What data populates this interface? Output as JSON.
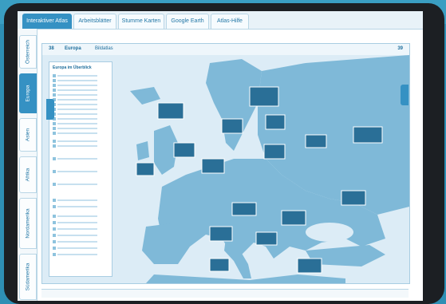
{
  "top_nav": {
    "tabs": [
      {
        "label": "Interaktiver Atlas",
        "active": true
      },
      {
        "label": "Arbeitsblätter",
        "active": false
      },
      {
        "label": "Stumme Karten",
        "active": false
      },
      {
        "label": "Google Earth",
        "active": false
      },
      {
        "label": "Atlas-Hilfe",
        "active": false
      }
    ]
  },
  "side_nav": {
    "items": [
      {
        "label": "Österreich",
        "active": false
      },
      {
        "label": "Europa",
        "active": true
      },
      {
        "label": "Asien",
        "active": false
      },
      {
        "label": "Afrika",
        "active": false
      },
      {
        "label": "Nordamerika",
        "active": false
      },
      {
        "label": "Südamerika",
        "active": false
      }
    ]
  },
  "page": {
    "left_number": "38",
    "right_number": "39",
    "title": "Europa",
    "subtitle": "Bildatlas"
  },
  "legend": {
    "title": "Europa im Überblick"
  },
  "colors": {
    "accent": "#3591c3",
    "background": "#2e8fb4",
    "device": "#1c1f23",
    "map_water": "#dcecf6",
    "map_land": "#7fb9d8"
  }
}
